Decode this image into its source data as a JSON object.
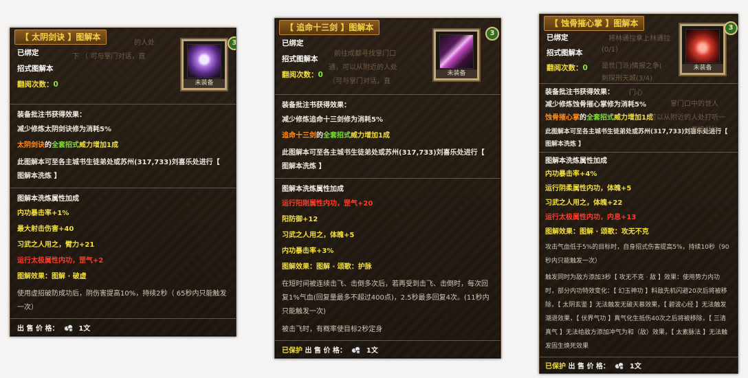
{
  "panel1": {
    "title": "【 太阴剑诀 】图解本",
    "bound": "已绑定",
    "type": "招式图解本",
    "read_label": "翻阅次数：",
    "read_count": "0",
    "equip_label": "未装备",
    "badge": "3",
    "ghost1": "的人处",
    "ghost2": "下 （ 可与掌门对话，直",
    "ann_head": "装备批注书获得效果：",
    "ann1": "减少修炼太阴剑诀修为消耗5%",
    "ann2_name": "太阴剑诀",
    "ann2_mid": "的",
    "ann2_all": "全套招式",
    "ann2_tail": "威力增加1成",
    "ann3": "此图解本可至各主城书生徒弟处或苏州(317,733)刘喜乐处进行【 图解本洗炼 】",
    "wash_head": "图解本洗炼属性加成",
    "w1": "内功暴击率+1%",
    "w2": "最大射击伤害+40",
    "w3": "习武之人用之，臂力+21",
    "w4": "运行太极属性内功，罡气+2",
    "w5": "图解效果：图解 · 破虚",
    "w6": "使用虚招破防成功后，阴伤害提高10%，持续2秒（ 65秒内只能触发一次）",
    "price_label": "出 售 价 格：",
    "price_value": "1文"
  },
  "panel2": {
    "title": "【 追命十三剑 】图解本",
    "bound": "已绑定",
    "type": "招式图解本",
    "read_label": "翻阅次数：",
    "read_count": "0",
    "equip_label": "未装备",
    "badge": "3",
    "ghost1": "前往成都寻找掌门口",
    "ghost2": "通，可以从附近的人处",
    "ghost3": "（可与掌门对话，直",
    "ann_head": "装备批注书获得效果：",
    "ann1": "减少修炼追命十三剑修为消耗5%",
    "ann2_name": "追命十三剑",
    "ann2_mid": "的",
    "ann2_all": "全套招式",
    "ann2_tail": "威力增加1成",
    "ann3": "此图解本可至各主城书生徒弟处或苏州(317,733)刘喜乐处进行【 图解本洗炼 】",
    "wash_head": "图解本洗炼属性加成",
    "w1": "运行阳刚属性内功，罡气+20",
    "w2": "阳防御+12",
    "w3": "习武之人用之，体魄+5",
    "w4": "内功暴击率+3%",
    "w5": "图解效果：图解 · 颂歌：护脉",
    "w6": "在短时间被连续击飞、击倒多次后，若再受到击飞、击倒时，每次回复1%气血(回复量最多不超过400点)，2.5秒最多回复4次。(11秒内只能触发一次)",
    "w7": "被击飞时，有概率使目标2秒定身",
    "price_prefix": "已保护",
    "price_label": "出 售 价 格：",
    "price_value": "1文"
  },
  "panel3": {
    "title": "【 蚀骨摧心掌 】图解本",
    "bound": "已绑定",
    "type": "招式图解本",
    "read_label": "翻阅次数：",
    "read_count": "0",
    "equip_label": "未装备",
    "badge": "3",
    "ghost1": "将林通拉拿上林通拉",
    "ghost2": "(0/1)",
    "ghost3": "是世门派)情报之争(",
    "ghost4": "刺探刑天城(3/4)",
    "ghost5": "门心",
    "ghost6": "掌门口中的世人",
    "ghost7": "可以从附近的人处打听一",
    "ghost8": "直接前往",
    "ann_head": "装备批注书获得效果：",
    "ann1": "减少修炼蚀骨摧心掌修为消耗5%",
    "ann2_name": "蚀骨摧心掌",
    "ann2_mid": "的",
    "ann2_all": "全套招式",
    "ann2_tail": "威力增加1成",
    "ann3": "此图解本可至各主城书生徒弟处或苏州(317,733)刘喜乐处进行【 图解本洗炼 】",
    "wash_head": "图解本洗炼属性加成",
    "w1": "内功暴击率+4%",
    "w2": "运行阴柔属性内功，体魄+5",
    "w3": "习武之人用之，体魄+22",
    "w4": "运行太极属性内功，内息+13",
    "w5": "图解效果：图解 · 颂歌：攻无不克",
    "w6": "攻击气血低于5%的目标时，自身招式伤害提高5%，持续10秒（90秒内只能触发一次）",
    "w7": "触发同时为敌方添加3秒【 攻无不克 · 敌 】效果：使用势力内功时，部分内功特效变化：【 幻玉神功 】料敌先机闪避20次后将被移除，【 太阴玄鉴 】无法触发无破天慕效果，【 碧波心经 】无法触发潮退效果，【 伏界气功 】真气化生抵伤40次之后将被移除，【 三清真气 】无法给敌方添加冲气为和（敌）效果，【 太素脉法 】无法触发固生焕死效果",
    "price_prefix": "已保护",
    "price_label": "出 售 价 格：",
    "price_value": "1文"
  },
  "colors": {
    "title_gold": "#f2d24b",
    "skill_name": "#ff8c1a",
    "all_moves": "#7ee03a",
    "highlight": "#f3df3c",
    "red_stat": "#ff3b2a"
  }
}
